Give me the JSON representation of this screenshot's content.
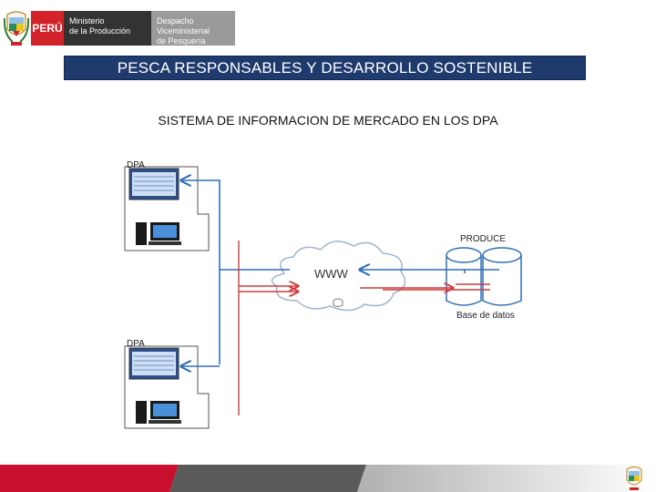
{
  "header": {
    "country": "PERÚ",
    "ministry": [
      "Ministerio",
      "de la Producción"
    ],
    "vice_ministry": [
      "Despacho Viceministerial",
      "de Pesquería"
    ]
  },
  "title": "PESCA RESPONSABLES Y DESARROLLO SOSTENIBLE",
  "subtitle": "SISTEMA DE INFORMACION DE MERCADO EN LOS DPA",
  "diagram": {
    "dpa_top_label": "DPA",
    "dpa_bottom_label": "DPA",
    "cloud_label": "WWW",
    "produce_label": "PRODUCE",
    "database_label": "Base de datos"
  },
  "colors": {
    "title_bg": "#1f3b6e",
    "peru_red": "#d2232a",
    "blue_arrow": "#2e6fb7",
    "red_arrow": "#d23a3a",
    "footer_red": "#c8102e",
    "footer_gray": "#5a5a5a"
  }
}
